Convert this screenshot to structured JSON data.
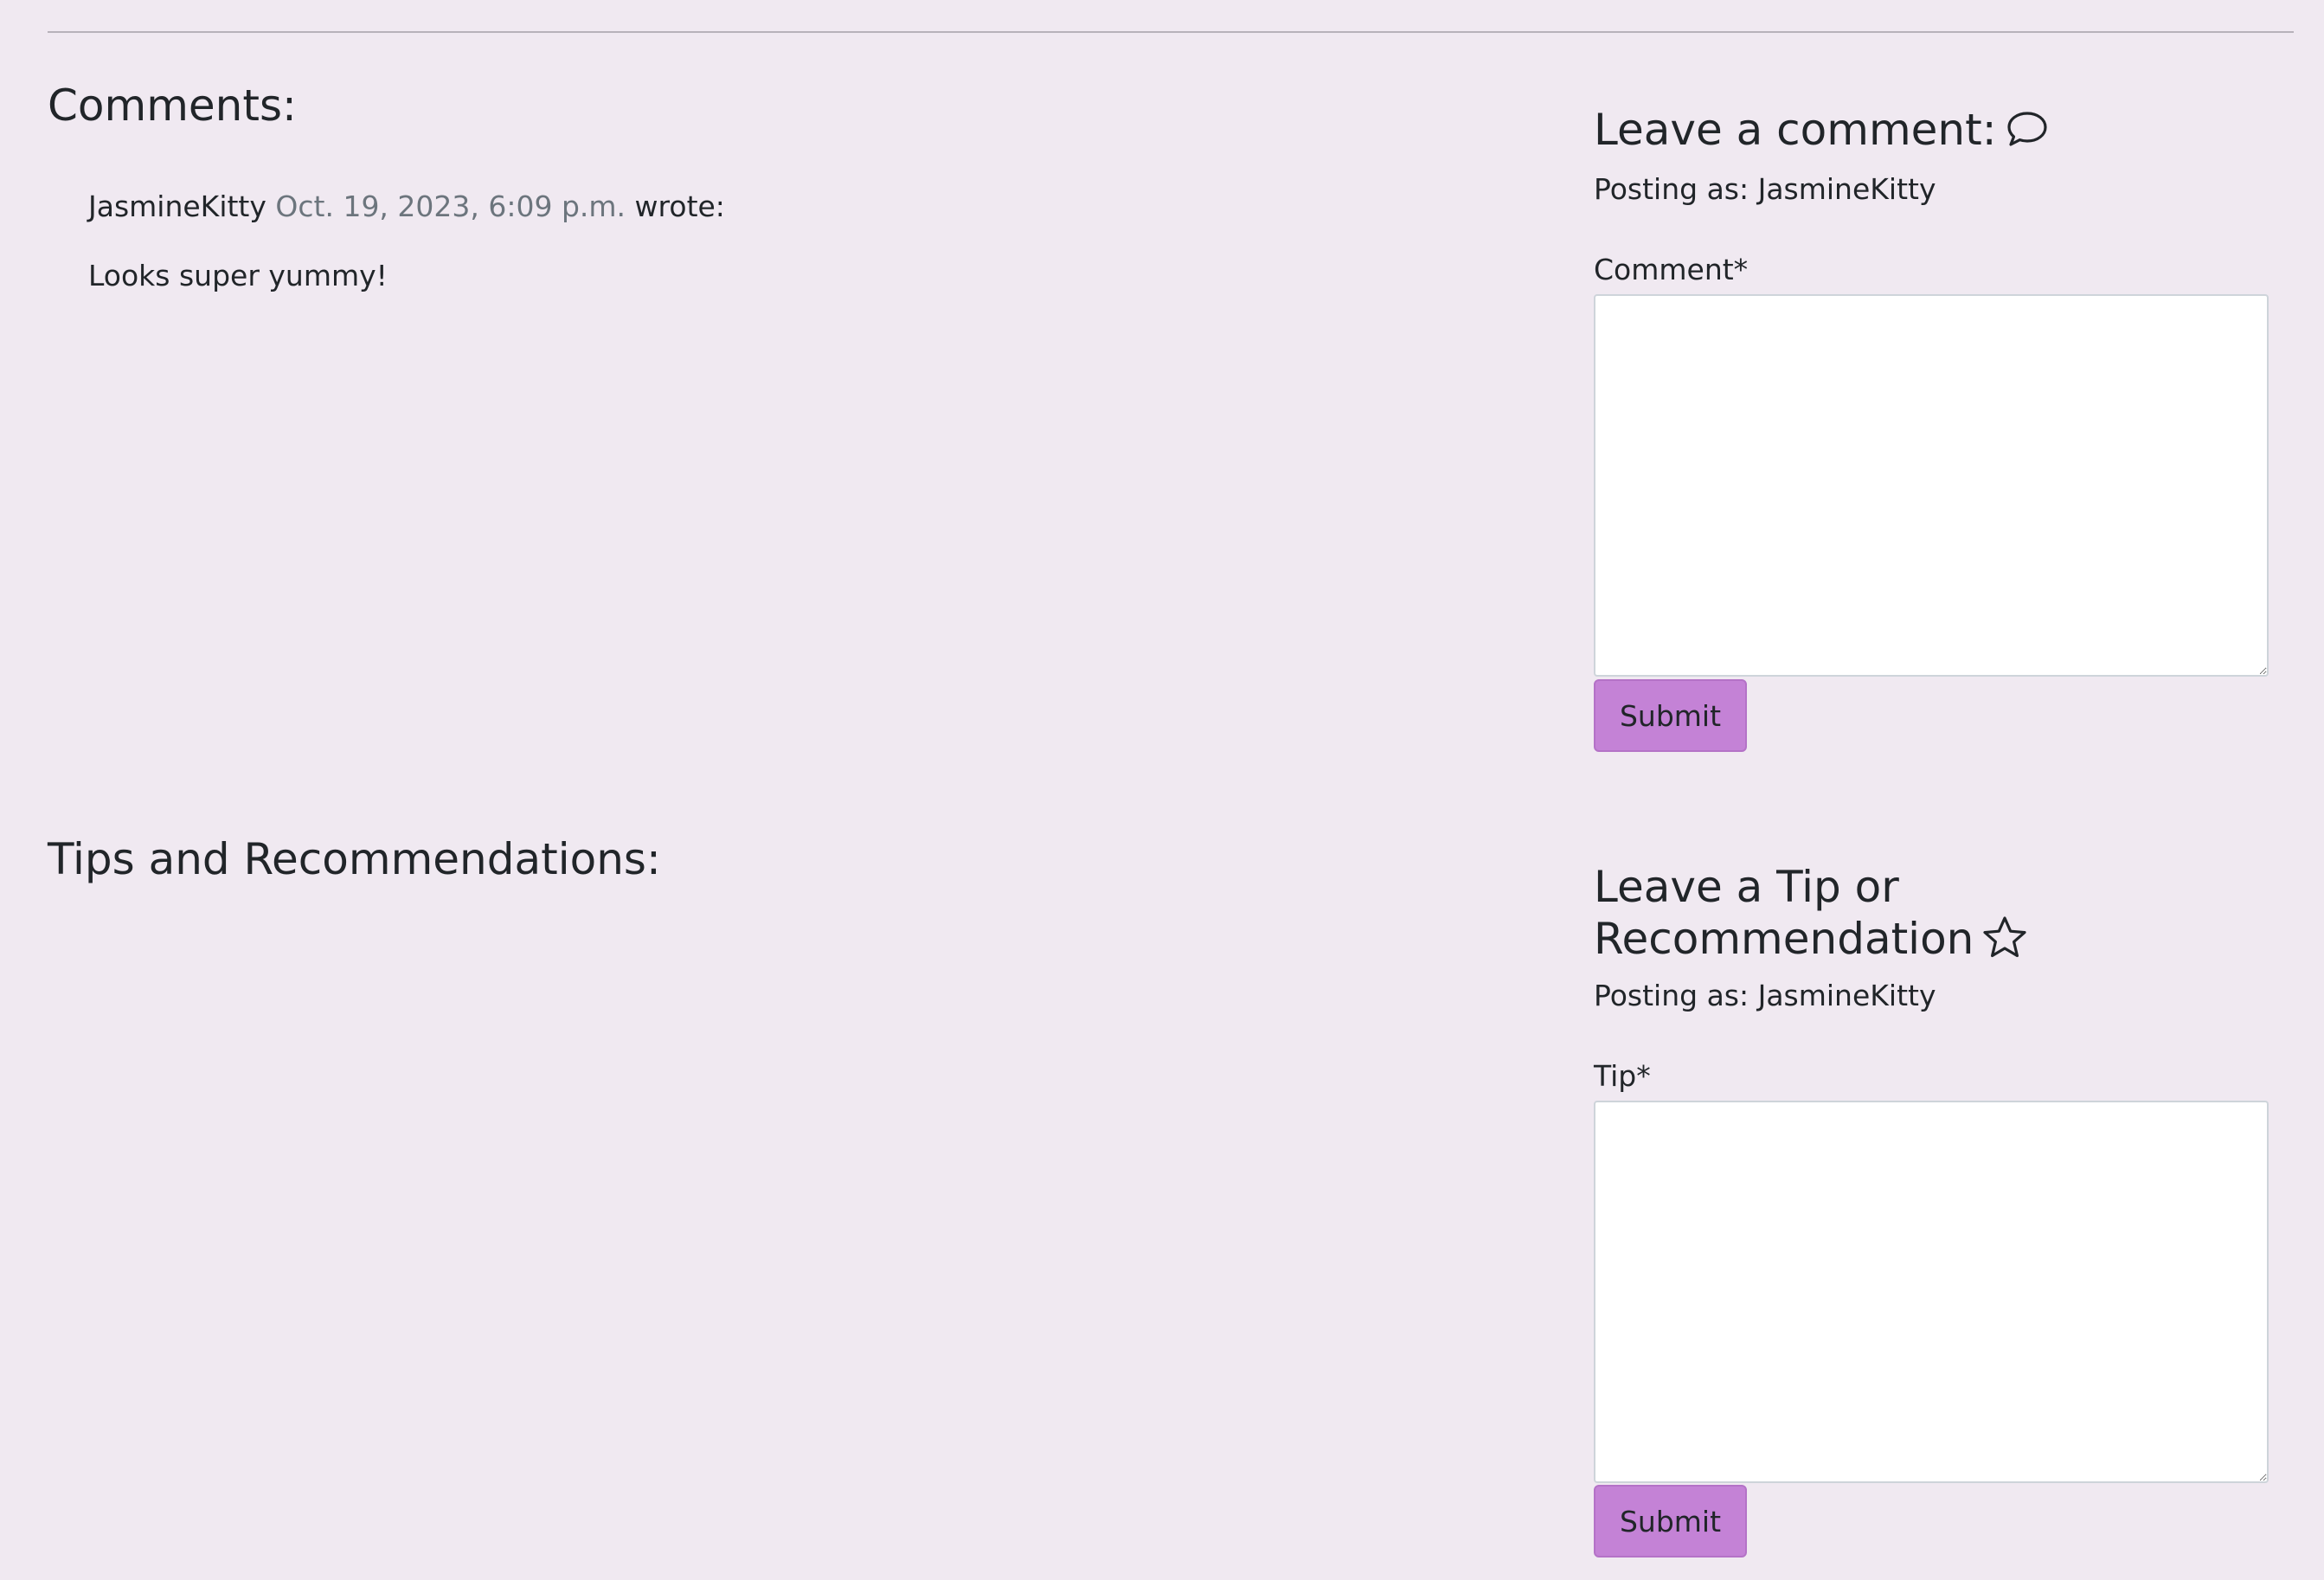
{
  "comments_section": {
    "heading": "Comments:",
    "comments": [
      {
        "author": "JasmineKitty",
        "date": "Oct. 19, 2023, 6:09 p.m.",
        "wrote": "wrote:",
        "body": "Looks super yummy!"
      }
    ]
  },
  "comment_form": {
    "heading": "Leave a comment:",
    "heading_icon": "speech-bubble-icon",
    "posting_as": "Posting as: JasmineKitty",
    "field_label": "Comment*",
    "value": "",
    "submit_label": "Submit"
  },
  "tips_section": {
    "heading": "Tips and Recommendations:"
  },
  "tip_form": {
    "heading": "Leave a Tip or Recommendation",
    "heading_icon": "star-icon",
    "posting_as": "Posting as: JasmineKitty",
    "field_label": "Tip*",
    "value": "",
    "submit_label": "Submit"
  },
  "colors": {
    "background": "#f0e9f1",
    "button": "#c482d6",
    "muted_text": "#6c757d"
  }
}
